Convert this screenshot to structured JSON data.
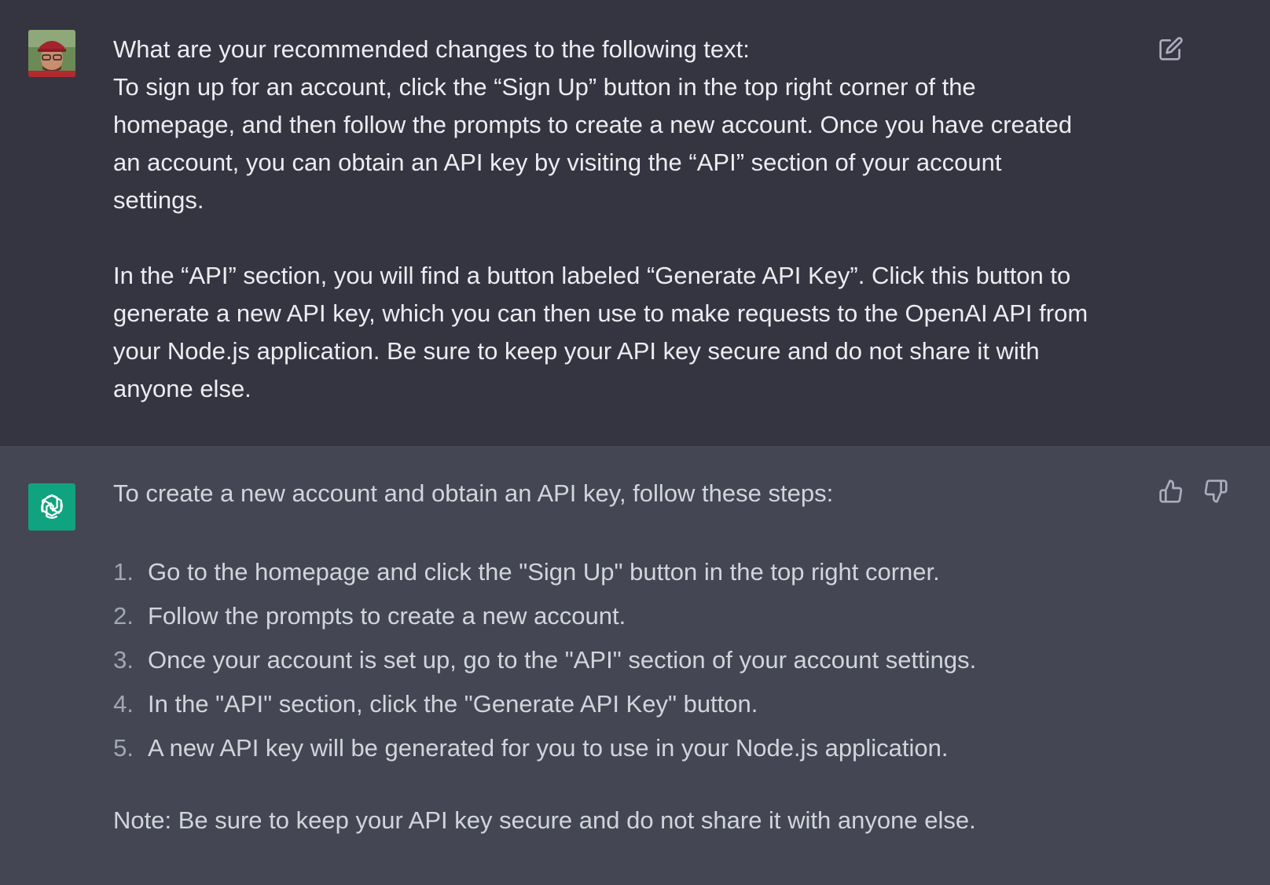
{
  "user_message": {
    "avatar": "user-photo-avatar",
    "lines": [
      "What are your recommended changes to the following text:",
      "To sign up for an account, click the “Sign Up” button in the top right corner of the",
      "homepage, and then follow the prompts to create a new account. Once you have created",
      "an account, you can obtain an API key by visiting the “API” section of your account",
      "settings."
    ],
    "lines2": [
      "In the “API” section, you will find a button labeled “Generate API Key”. Click this button to",
      "generate a new API key, which you can then use to make requests to the OpenAI API from",
      "your Node.js application. Be sure to keep your API key secure and do not share it with",
      "anyone else."
    ],
    "edit_icon": "edit-icon"
  },
  "assistant_message": {
    "avatar": "openai-logo-icon",
    "intro": "To create a new account and obtain an API key, follow these steps:",
    "steps": [
      {
        "num": "1.",
        "text": "Go to the homepage and click the \"Sign Up\" button in the top right corner."
      },
      {
        "num": "2.",
        "text": "Follow the prompts to create a new account."
      },
      {
        "num": "3.",
        "text": "Once your account is set up, go to the \"API\" section of your account settings."
      },
      {
        "num": "4.",
        "text": "In the \"API\" section, click the \"Generate API Key\" button."
      },
      {
        "num": "5.",
        "text": "A new API key will be generated for you to use in your Node.js application."
      }
    ],
    "note": "Note: Be sure to keep your API key secure and do not share it with anyone else.",
    "thumbs_up_icon": "thumbs-up-icon",
    "thumbs_down_icon": "thumbs-down-icon"
  },
  "colors": {
    "user_bg": "#343541",
    "assistant_bg": "#444654",
    "brand": "#10a37f",
    "text": "#ececf1",
    "icon": "#acacbe"
  }
}
